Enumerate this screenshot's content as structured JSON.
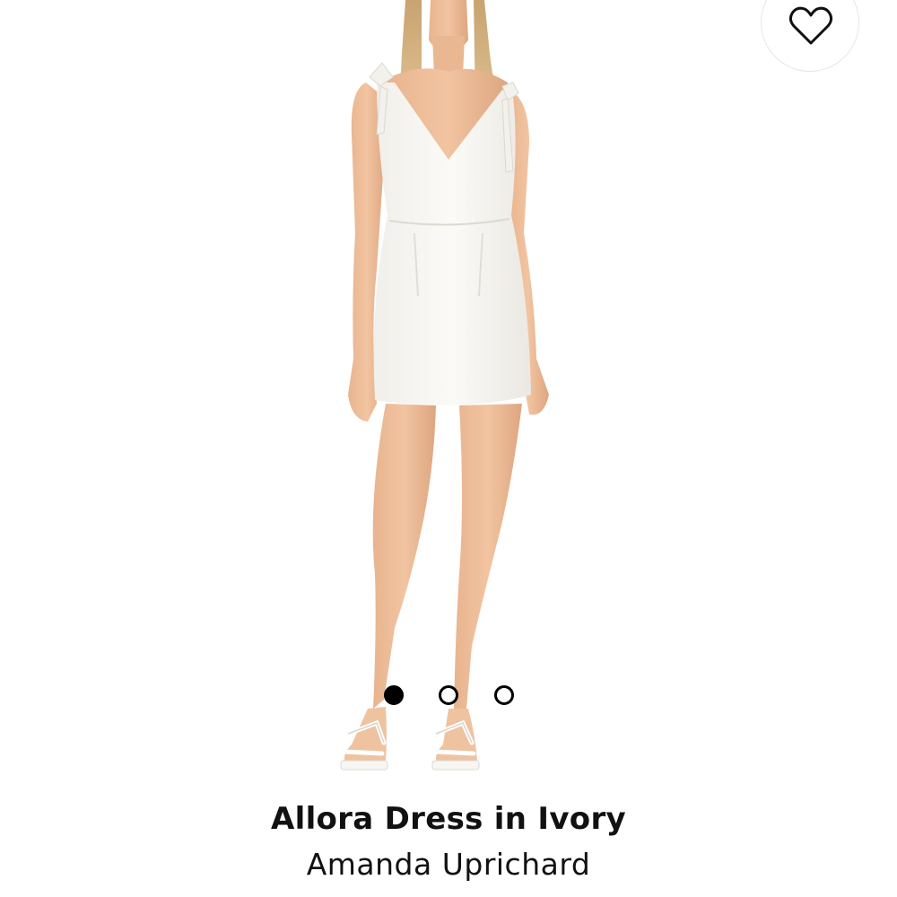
{
  "product": {
    "title": "Allora Dress in Ivory",
    "brand": "Amanda Uprichard",
    "image_alt": "Model wearing white sleeveless mini dress with shoulder ties and strappy white sandals"
  },
  "carousel": {
    "total": 3,
    "active_index": 1
  },
  "icons": {
    "wishlist": "heart-outline-icon"
  },
  "colors": {
    "background": "#ffffff",
    "text": "#111111",
    "dot_active": "#000000"
  }
}
